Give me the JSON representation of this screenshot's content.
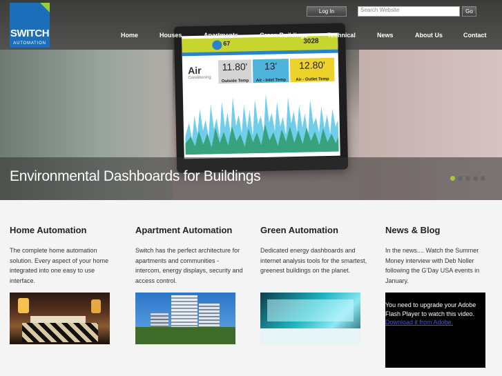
{
  "header": {
    "logo_text": "SWITCH",
    "logo_sub": "AUTOMATION",
    "login_label": "Log In",
    "search_placeholder": "Search Website",
    "go_label": "Go",
    "brand_colors": {
      "logo_blue": "#1d6eb8",
      "logo_green": "#9ccc3c"
    }
  },
  "nav": {
    "items": [
      "Home",
      "Houses",
      "Apartments",
      "Green Buildings",
      "Technical",
      "News",
      "About Us",
      "Contact"
    ]
  },
  "hero": {
    "caption": "Environmental Dashboards for Buildings",
    "slide_count": 5,
    "active_slide": 1,
    "dashboard": {
      "temp_reading": "67",
      "power_reading": "3028",
      "system_label": "Air",
      "system_sub": "Conditioning",
      "tiles": [
        {
          "value": "11.80'",
          "label": "Outside Temp"
        },
        {
          "value": "13'",
          "label": "Air - Inlet Temp"
        },
        {
          "value": "12.80'",
          "label": "Air - Outlet Temp"
        }
      ]
    }
  },
  "columns": [
    {
      "title": "Home Automation",
      "text": "The complete home automation solution. Every aspect of your home integrated into one easy to use interface."
    },
    {
      "title": "Apartment Automation",
      "text": "Switch has the perfect architecture for apartments and communities - intercom, energy displays, security and access control."
    },
    {
      "title": "Green Automation",
      "text": "Dedicated energy dashboards and internet analysis tools for the smartest, greenest buildings on the planet."
    },
    {
      "title": "News & Blog",
      "text": "In the news.... Watch the Summer Money interview with Deb Noller following the G'Day USA events in January.",
      "flash_message": "You need to upgrade your Adobe Flash Player to watch this video.",
      "flash_link": "Download it from Adobe."
    }
  ]
}
